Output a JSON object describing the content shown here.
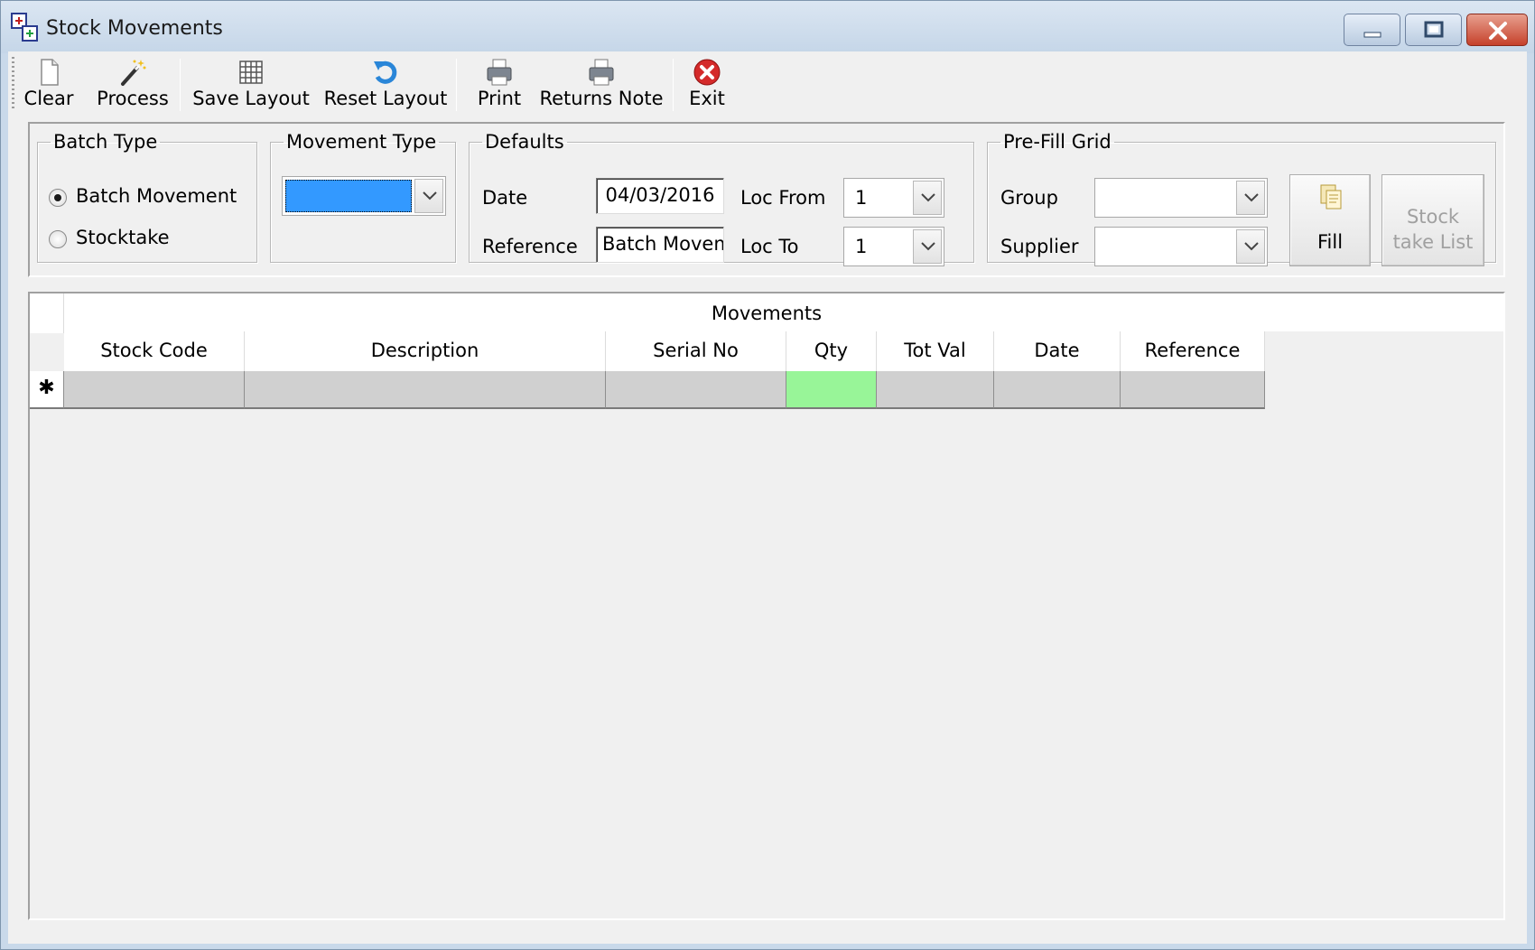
{
  "window": {
    "title": "Stock Movements"
  },
  "toolbar": {
    "clear": "Clear",
    "process": "Process",
    "save_layout": "Save Layout",
    "reset_layout": "Reset Layout",
    "print": "Print",
    "returns_note": "Returns Note",
    "exit": "Exit"
  },
  "batch_type": {
    "legend": "Batch Type",
    "options": [
      "Batch Movement",
      "Stocktake"
    ],
    "selected": "Batch Movement"
  },
  "movement_type": {
    "legend": "Movement Type",
    "value": ""
  },
  "defaults": {
    "legend": "Defaults",
    "date_label": "Date",
    "date_value": "04/03/2016",
    "reference_label": "Reference",
    "reference_value": "Batch Movem",
    "loc_from_label": "Loc From",
    "loc_from_value": "1",
    "loc_to_label": "Loc To",
    "loc_to_value": "1"
  },
  "prefill": {
    "legend": "Pre-Fill Grid",
    "group_label": "Group",
    "group_value": "",
    "supplier_label": "Supplier",
    "supplier_value": "",
    "fill_button": "Fill",
    "stocktake_button_line1": "Stock",
    "stocktake_button_line2": "take List"
  },
  "grid": {
    "caption": "Movements",
    "columns": [
      "Stock Code",
      "Description",
      "Serial No",
      "Qty",
      "Tot Val",
      "Date",
      "Reference"
    ],
    "new_row_marker": "✱"
  },
  "colors": {
    "qty_cell": "#98f598",
    "selected_combo": "#3399ff"
  }
}
